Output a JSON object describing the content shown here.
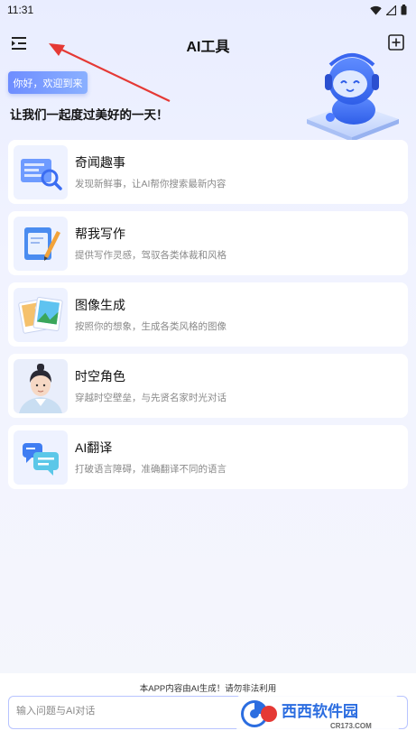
{
  "status_bar": {
    "time": "11:31"
  },
  "header": {
    "title": "AI工具"
  },
  "hero": {
    "greeting": "你好，欢迎到来",
    "slogan": "让我们一起度过美好的一天！"
  },
  "cards": [
    {
      "title": "奇闻趣事",
      "desc": "发现新鲜事，让AI帮你搜索最新内容",
      "icon": "search-doc-icon"
    },
    {
      "title": "帮我写作",
      "desc": "提供写作灵感，驾驭各类体裁和风格",
      "icon": "writing-book-icon"
    },
    {
      "title": "图像生成",
      "desc": "按照你的想象，生成各类风格的图像",
      "icon": "image-gallery-icon"
    },
    {
      "title": "时空角色",
      "desc": "穿越时空壁垒，与先贤名家时光对话",
      "icon": "historical-character-avatar"
    },
    {
      "title": "AI翻译",
      "desc": "打破语言障碍，准确翻译不同的语言",
      "icon": "translate-bubbles-icon"
    }
  ],
  "footer": {
    "disclaimer": "本APP内容由AI生成！请勿非法利用",
    "input_placeholder": "输入问题与AI对话"
  },
  "watermark": {
    "brand": "西西软件园",
    "site": "CR173.COM"
  },
  "colors": {
    "accent": "#6e8dff",
    "arrow": "#e53935",
    "background": "#eef1ff"
  }
}
